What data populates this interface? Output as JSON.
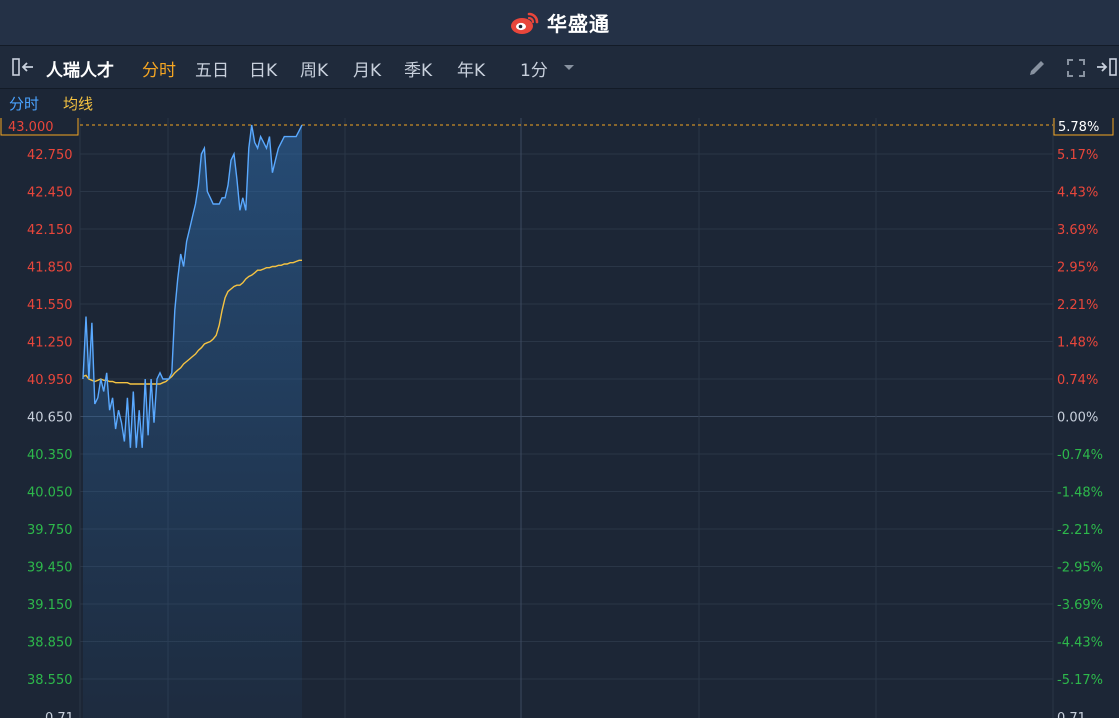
{
  "brand": {
    "name": "华盛通"
  },
  "toolbar": {
    "stock_name": "人瑞人才",
    "periods": [
      "分时",
      "五日",
      "日K",
      "周K",
      "月K",
      "季K",
      "年K"
    ],
    "active_period": "分时",
    "interval": "1分"
  },
  "legend": {
    "time_label": "分时",
    "avg_label": "均线"
  },
  "colors": {
    "up": "#e8463b",
    "down": "#2db84b",
    "neutral": "#c8d0dc",
    "price_line": "#5aa9ff",
    "avg_line": "#f5c342",
    "active": "#f5a623"
  },
  "chart_data": {
    "type": "line",
    "prev_close": 40.65,
    "current_price_label": "43.000",
    "current_pct_label": "5.78%",
    "ylim": [
      38.4,
      43.0
    ],
    "y_ticks": [
      "43.000",
      "42.750",
      "42.450",
      "42.150",
      "41.850",
      "41.550",
      "41.250",
      "40.950",
      "40.650",
      "40.350",
      "40.050",
      "39.750",
      "39.450",
      "39.150",
      "38.850",
      "38.550"
    ],
    "pct_ticks": [
      "5.78%",
      "5.17%",
      "4.43%",
      "3.69%",
      "2.95%",
      "2.21%",
      "1.48%",
      "0.74%",
      "0.00%",
      "-0.74%",
      "-1.48%",
      "-2.21%",
      "-2.95%",
      "-3.69%",
      "-4.43%",
      "-5.17%"
    ],
    "bottom_left_label": "0.71",
    "bottom_right_label": "0.71",
    "session_minutes": 330,
    "series": [
      {
        "values": [
          40.95,
          41.45,
          40.95,
          41.4,
          40.75,
          40.8,
          40.95,
          40.85,
          41.0,
          40.7,
          40.8,
          40.55,
          40.7,
          40.6,
          40.45,
          40.8,
          40.4,
          40.85,
          40.4,
          40.7,
          40.4,
          40.95,
          40.5,
          40.95,
          40.6,
          40.95,
          41.0,
          40.95,
          40.95,
          40.95,
          41.0,
          41.5,
          41.75,
          41.95,
          41.85,
          42.05,
          42.15,
          42.25,
          42.35,
          42.5,
          42.75,
          42.8,
          42.45,
          42.4,
          42.35,
          42.35,
          42.35,
          42.4,
          42.4,
          42.5,
          42.7,
          42.75,
          42.55,
          42.3,
          42.4,
          42.3,
          42.8,
          43.0,
          42.85,
          42.8,
          42.9,
          42.85,
          42.8,
          42.9,
          42.6,
          42.7,
          42.8,
          42.85,
          42.9,
          42.9,
          42.9,
          42.9,
          42.9,
          42.95,
          43.0
        ]
      },
      {
        "values": [
          40.97,
          40.98,
          40.95,
          40.94,
          40.93,
          40.94,
          40.95,
          40.94,
          40.94,
          40.93,
          40.93,
          40.92,
          40.92,
          40.92,
          40.92,
          40.92,
          40.91,
          40.91,
          40.91,
          40.91,
          40.91,
          40.91,
          40.91,
          40.91,
          40.91,
          40.91,
          40.91,
          40.92,
          40.93,
          40.95,
          40.97,
          41.0,
          41.02,
          41.04,
          41.07,
          41.09,
          41.11,
          41.13,
          41.15,
          41.18,
          41.2,
          41.23,
          41.24,
          41.25,
          41.27,
          41.3,
          41.38,
          41.5,
          41.6,
          41.65,
          41.67,
          41.69,
          41.7,
          41.7,
          41.72,
          41.75,
          41.77,
          41.78,
          41.8,
          41.82,
          41.82,
          41.83,
          41.84,
          41.84,
          41.85,
          41.85,
          41.86,
          41.86,
          41.87,
          41.87,
          41.88,
          41.88,
          41.89,
          41.9,
          41.9
        ]
      }
    ]
  }
}
